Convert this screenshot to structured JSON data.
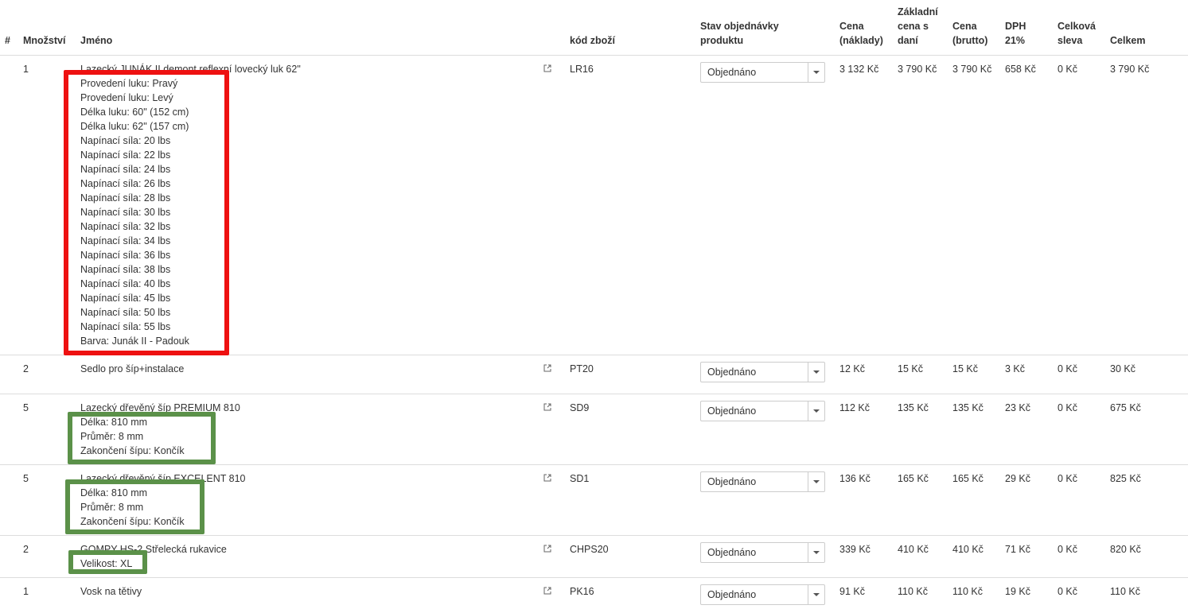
{
  "columns": {
    "num": "#",
    "qty": "Množství",
    "name": "Jméno",
    "code": "kód zboží",
    "status_l1": "Stav objednávky",
    "status_l2": "produktu",
    "cost_l1": "Cena",
    "cost_l2": "(náklady)",
    "base_l1": "Základní",
    "base_l2": "cena s",
    "base_l3": "daní",
    "gross_l1": "Cena",
    "gross_l2": "(brutto)",
    "vat_l1": "DPH",
    "vat_l2": "21%",
    "disc_l1": "Celková",
    "disc_l2": "sleva",
    "total": "Celkem"
  },
  "highlight_colors": {
    "red": "#ee1111",
    "green": "#5b9149"
  },
  "rows": [
    {
      "qty": "1",
      "name": "Lazecký JUNÁK II demont reflexní lovecký luk 62\"",
      "attrs": [
        "Provedení luku: Pravý",
        "Provedení luku: Levý",
        "Délka luku: 60\" (152 cm)",
        "Délka luku: 62\" (157 cm)",
        "Napínací síla: 20 lbs",
        "Napínací síla: 22 lbs",
        "Napínací síla: 24 lbs",
        "Napínací síla: 26 lbs",
        "Napínací síla: 28 lbs",
        "Napínací síla: 30 lbs",
        "Napínací síla: 32 lbs",
        "Napínací síla: 34 lbs",
        "Napínací síla: 36 lbs",
        "Napínací síla: 38 lbs",
        "Napínací síla: 40 lbs",
        "Napínací síla: 45 lbs",
        "Napínací síla: 50 lbs",
        "Napínací síla: 55 lbs",
        "Barva: Junák II - Padouk"
      ],
      "code": "LR16",
      "status": "Objednáno",
      "cost": "3 132 Kč",
      "base": "3 790 Kč",
      "gross": "3 790 Kč",
      "vat": "658 Kč",
      "disc": "0 Kč",
      "total": "3 790 Kč"
    },
    {
      "qty": "2",
      "name": "Sedlo pro šíp+instalace",
      "attrs": [],
      "code": "PT20",
      "status": "Objednáno",
      "cost": "12 Kč",
      "base": "15 Kč",
      "gross": "15 Kč",
      "vat": "3 Kč",
      "disc": "0 Kč",
      "total": "30 Kč"
    },
    {
      "qty": "5",
      "name": "Lazecký dřevěný šíp PREMIUM 810",
      "attrs": [
        "Délka: 810 mm",
        "Průměr: 8 mm",
        "Zakončení šípu: Končík"
      ],
      "code": "SD9",
      "status": "Objednáno",
      "cost": "112 Kč",
      "base": "135 Kč",
      "gross": "135 Kč",
      "vat": "23 Kč",
      "disc": "0 Kč",
      "total": "675 Kč"
    },
    {
      "qty": "5",
      "name": "Lazecký dřevěný šíp EXCELENT 810",
      "attrs": [
        "Délka: 810 mm",
        "Průměr: 8 mm",
        "Zakončení šípu: Končík"
      ],
      "code": "SD1",
      "status": "Objednáno",
      "cost": "136 Kč",
      "base": "165 Kč",
      "gross": "165 Kč",
      "vat": "29 Kč",
      "disc": "0 Kč",
      "total": "825 Kč"
    },
    {
      "qty": "2",
      "name": "GOMPY HS-2 Střelecká rukavice",
      "attrs": [
        "Velikost: XL"
      ],
      "code": "CHPS20",
      "status": "Objednáno",
      "cost": "339 Kč",
      "base": "410 Kč",
      "gross": "410 Kč",
      "vat": "71 Kč",
      "disc": "0 Kč",
      "total": "820 Kč"
    },
    {
      "qty": "1",
      "name": "Vosk na tětivy",
      "attrs": [],
      "code": "PK16",
      "status": "Objednáno",
      "cost": "91 Kč",
      "base": "110 Kč",
      "gross": "110 Kč",
      "vat": "19 Kč",
      "disc": "0 Kč",
      "total": "110 Kč"
    }
  ]
}
